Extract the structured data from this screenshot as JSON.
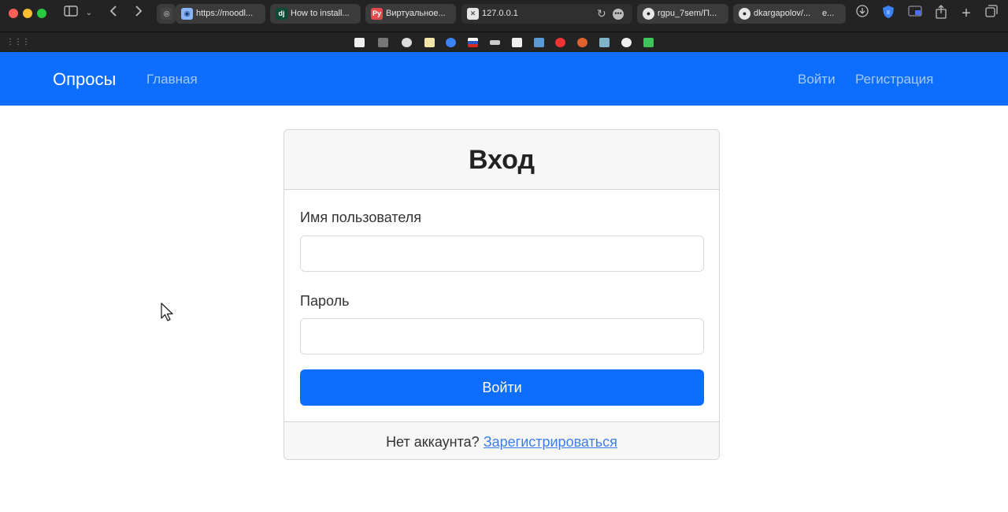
{
  "browser": {
    "tabs": [
      {
        "label": "",
        "icon": "chatgpt-icon",
        "color": "#d9d9d9"
      },
      {
        "label": "https://moodl...",
        "icon": "globe-icon",
        "color": "#8ab4f8"
      },
      {
        "label": "How to install...",
        "icon": "django-icon",
        "color": "#0c4b33"
      },
      {
        "label": "Виртуальное...",
        "icon": "python-icon",
        "color": "#e5484d"
      },
      {
        "label": "127.0.0.1",
        "icon": "close-icon",
        "color": "#e6e6e6"
      },
      {
        "label": "rgpu_7sem/П...",
        "icon": "github-icon",
        "color": "#e6e6e6"
      },
      {
        "label": "dkargapolov/...",
        "icon": "github-icon",
        "color": "#e6e6e6"
      },
      {
        "label": "е...",
        "icon": "",
        "color": "#e6e6e6"
      }
    ]
  },
  "site": {
    "brand": "Опросы",
    "nav_home": "Главная",
    "nav_login": "Войти",
    "nav_register": "Регистрация",
    "colors": {
      "primary": "#0d6efd"
    }
  },
  "login": {
    "title": "Вход",
    "username_label": "Имя пользователя",
    "username_value": "",
    "password_label": "Пароль",
    "password_value": "",
    "submit_label": "Войти",
    "footer_text": "Нет аккаунта?",
    "footer_link": "Зарегистрироваться"
  }
}
